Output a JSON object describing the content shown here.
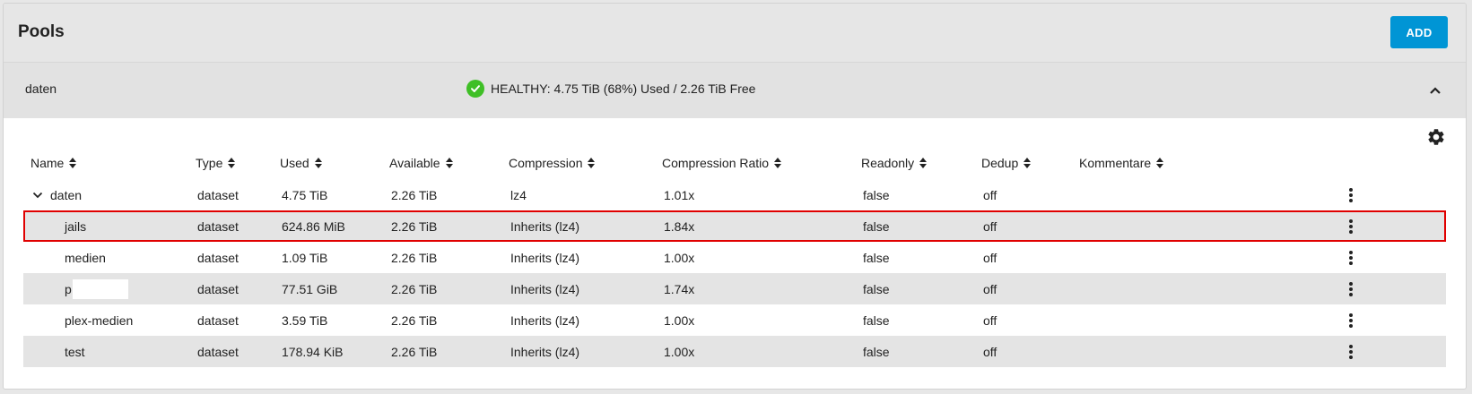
{
  "header": {
    "title": "Pools",
    "add_label": "ADD"
  },
  "pool": {
    "name": "daten",
    "status": "HEALTHY: 4.75 TiB (68%) Used / 2.26 TiB Free",
    "status_color": "#3fbf26"
  },
  "table": {
    "columns": [
      "Name",
      "Type",
      "Used",
      "Available",
      "Compression",
      "Compression Ratio",
      "Readonly",
      "Dedup",
      "Kommentare"
    ],
    "rows": [
      {
        "name": "daten",
        "type": "dataset",
        "used": "4.75 TiB",
        "available": "2.26 TiB",
        "compression": "lz4",
        "ratio": "1.01x",
        "readonly": "false",
        "dedup": "off",
        "comment": ""
      },
      {
        "name": "jails",
        "type": "dataset",
        "used": "624.86 MiB",
        "available": "2.26 TiB",
        "compression": "Inherits (lz4)",
        "ratio": "1.84x",
        "readonly": "false",
        "dedup": "off",
        "comment": ""
      },
      {
        "name": "medien",
        "type": "dataset",
        "used": "1.09 TiB",
        "available": "2.26 TiB",
        "compression": "Inherits (lz4)",
        "ratio": "1.00x",
        "readonly": "false",
        "dedup": "off",
        "comment": ""
      },
      {
        "name": "p",
        "type": "dataset",
        "used": "77.51 GiB",
        "available": "2.26 TiB",
        "compression": "Inherits (lz4)",
        "ratio": "1.74x",
        "readonly": "false",
        "dedup": "off",
        "comment": ""
      },
      {
        "name": "plex-medien",
        "type": "dataset",
        "used": "3.59 TiB",
        "available": "2.26 TiB",
        "compression": "Inherits (lz4)",
        "ratio": "1.00x",
        "readonly": "false",
        "dedup": "off",
        "comment": ""
      },
      {
        "name": "test",
        "type": "dataset",
        "used": "178.94 KiB",
        "available": "2.26 TiB",
        "compression": "Inherits (lz4)",
        "ratio": "1.00x",
        "readonly": "false",
        "dedup": "off",
        "comment": ""
      }
    ]
  },
  "colors": {
    "accent": "#0095d5",
    "highlight_border": "#e00000",
    "row_shade": "#e4e4e4"
  },
  "icons": {
    "status": "check-circle-icon",
    "collapse": "chevron-up-icon",
    "settings": "gear-icon",
    "sort": "sort-icon",
    "expand": "chevron-down-icon",
    "row_menu": "more-vert-icon"
  }
}
